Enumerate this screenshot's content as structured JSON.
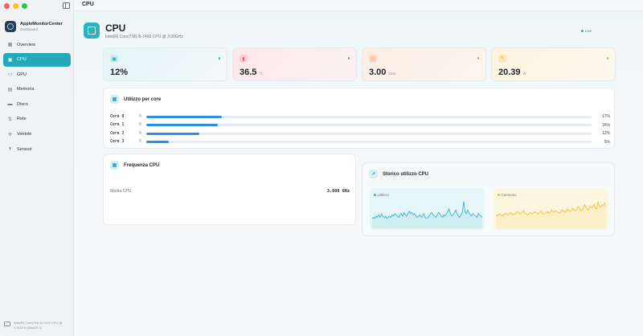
{
  "app": {
    "name": "AppleMonitorCenter",
    "subtitle": "Dashboard"
  },
  "toolbar": {
    "title": "CPU"
  },
  "sidebar": {
    "items": [
      {
        "label": "Overview",
        "icon": "overview-icon",
        "active": false
      },
      {
        "label": "CPU",
        "icon": "cpu-icon",
        "active": true
      },
      {
        "label": "GPU",
        "icon": "gpu-icon",
        "active": false
      },
      {
        "label": "Memoria",
        "icon": "memory-icon",
        "active": false
      },
      {
        "label": "Disco",
        "icon": "disk-icon",
        "active": false
      },
      {
        "label": "Rete",
        "icon": "network-icon",
        "active": false
      },
      {
        "label": "Ventole",
        "icon": "fan-icon",
        "active": false
      },
      {
        "label": "Sensori",
        "icon": "sensor-icon",
        "active": false
      }
    ],
    "footer": "Intel(R) Core(TM) i5-7400 CPU @ 3.00GHz (Mac20,1)"
  },
  "header": {
    "title": "CPU",
    "subtitle": "Intel(R) Core(TM) i5-7400 CPU @ 3.00GHz",
    "status": "Live"
  },
  "metrics": [
    {
      "value": "12%",
      "unit": "",
      "color": "#2aa9b8",
      "icon": "cpu-icon"
    },
    {
      "value": "36.5",
      "unit": "°C",
      "color": "#e25a72",
      "icon": "thermometer-icon"
    },
    {
      "value": "3.00",
      "unit": "GHz",
      "color": "#e98b4c",
      "icon": "clock-icon"
    },
    {
      "value": "20.39",
      "unit": "W",
      "color": "#e6ac2e",
      "icon": "bolt-icon"
    }
  ],
  "cores_panel": {
    "title": "Utilizzo per core",
    "cores": [
      {
        "name": "Core 0",
        "index": "0",
        "percent": 17,
        "label": "17%"
      },
      {
        "name": "Core 1",
        "index": "0",
        "percent": 16,
        "label": "16%"
      },
      {
        "name": "Core 2",
        "index": "0",
        "percent": 12,
        "label": "12%"
      },
      {
        "name": "Core 3",
        "index": "0",
        "percent": 5,
        "label": "5%"
      }
    ]
  },
  "frequency_panel": {
    "title": "Frequenza CPU",
    "label": "Media CPU",
    "value": "3.000 GHz"
  },
  "history_panel": {
    "title": "Storico utilizzo CPU",
    "series": [
      {
        "name": "Utilizzo",
        "color": "#39b5cc",
        "values": [
          8,
          9,
          8,
          10,
          9,
          11,
          9,
          12,
          10,
          9,
          10,
          8,
          9,
          10,
          9,
          11,
          10,
          12,
          11,
          10,
          9,
          11,
          12,
          10,
          13,
          11,
          10,
          12,
          14,
          12,
          13,
          11,
          12,
          10,
          9,
          10,
          11,
          9,
          10,
          12,
          9,
          8,
          9,
          10,
          12,
          13,
          11,
          10,
          9,
          11,
          13,
          12,
          10,
          9,
          11,
          10,
          12,
          14,
          16,
          12,
          10,
          11,
          13,
          15,
          12,
          10,
          9,
          11,
          13,
          22,
          14,
          12,
          15,
          13,
          11,
          10,
          12,
          11,
          10,
          9,
          12,
          11,
          10,
          9
        ]
      },
      {
        "name": "Consumo",
        "color": "#f0c12e",
        "values": [
          16,
          15,
          16,
          17,
          16,
          15,
          16,
          18,
          17,
          16,
          17,
          19,
          18,
          16,
          17,
          18,
          20,
          19,
          17,
          18,
          19,
          21,
          18,
          17,
          16,
          18,
          19,
          17,
          18,
          20,
          19,
          18,
          17,
          19,
          21,
          18,
          17,
          18,
          19,
          20,
          18,
          19,
          22,
          20,
          19,
          21,
          20,
          19,
          18,
          20,
          22,
          21,
          19,
          20,
          23,
          21,
          20,
          22,
          24,
          22,
          21,
          23,
          26,
          24,
          21,
          22,
          25,
          28,
          24,
          22,
          23,
          27,
          25,
          26,
          29,
          24,
          23,
          32,
          26,
          25,
          28,
          27,
          30,
          26
        ]
      }
    ]
  }
}
